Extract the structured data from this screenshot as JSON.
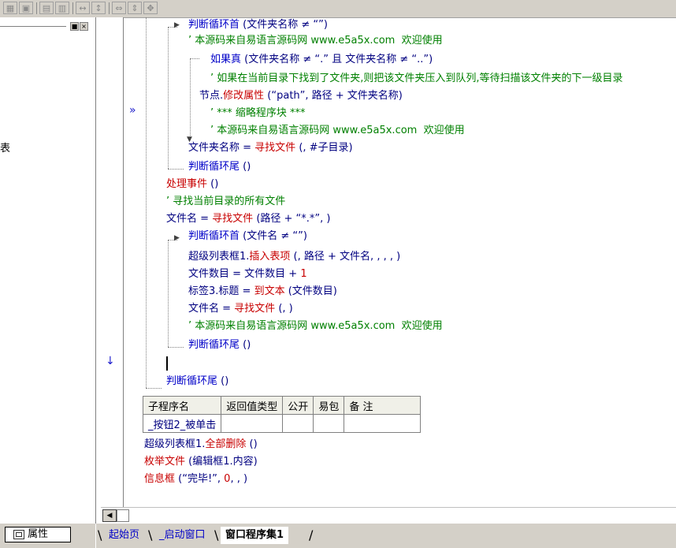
{
  "toolbar": {
    "buttons": [
      {
        "id": "tb1",
        "glyph": "▦"
      },
      {
        "id": "tb2",
        "glyph": "▣"
      },
      {
        "id": "tb3",
        "glyph": "▤"
      },
      {
        "id": "tb4",
        "glyph": "▥"
      },
      {
        "id": "tb5",
        "glyph": "↔"
      },
      {
        "id": "tb6",
        "glyph": "↕"
      },
      {
        "id": "tb7",
        "glyph": "⇔"
      },
      {
        "id": "tb8",
        "glyph": "⇕"
      },
      {
        "id": "tb9",
        "glyph": "✥"
      }
    ]
  },
  "left_panel": {
    "partial_text": "表",
    "pin_glyph": "■",
    "close_glyph": "×",
    "properties_tab": "属性"
  },
  "gutter": {
    "current_marker": "»",
    "down_marker": "↓"
  },
  "code_lines": [
    {
      "parts": [
        {
          "t": "判断循环首",
          "c": "blue"
        },
        {
          "t": " (文件夹名称 ≠ “”)",
          "c": "dark"
        }
      ]
    },
    {
      "parts": [
        {
          "t": "’ 本源码来自易语言源码网 www.e5a5x.com  欢迎使用",
          "c": "green"
        }
      ]
    },
    {
      "parts": [
        {
          "t": "如果真",
          "c": "blue"
        },
        {
          "t": " (文件夹名称 ≠ “.” 且 文件夹名称 ≠ “..”)",
          "c": "dark"
        }
      ]
    },
    {
      "parts": [
        {
          "t": "’ 如果在当前目录下找到了文件夹,则把该文件夹压入到队列,等待扫描该文件夹的下一级目录",
          "c": "green"
        }
      ]
    },
    {
      "parts": [
        {
          "t": "节点.",
          "c": "dark"
        },
        {
          "t": "修改属性",
          "c": "red"
        },
        {
          "t": " (“path”, 路径 + 文件夹名称)",
          "c": "dark"
        }
      ]
    },
    {
      "parts": [
        {
          "t": "’ *** 缩略程序块 ***",
          "c": "green"
        }
      ]
    },
    {
      "parts": [
        {
          "t": "’ 本源码来自易语言源码网 www.e5a5x.com  欢迎使用",
          "c": "green"
        }
      ]
    },
    {
      "parts": [
        {
          "t": "文件夹名称 = ",
          "c": "dark"
        },
        {
          "t": "寻找文件",
          "c": "red"
        },
        {
          "t": " (, #子目录)",
          "c": "dark"
        }
      ]
    },
    {
      "parts": [
        {
          "t": "判断循环尾",
          "c": "blue"
        },
        {
          "t": " ()",
          "c": "dark"
        }
      ]
    },
    {
      "parts": [
        {
          "t": "处理事件",
          "c": "red"
        },
        {
          "t": " ()",
          "c": "dark"
        }
      ]
    },
    {
      "parts": [
        {
          "t": "’ 寻找当前目录的所有文件",
          "c": "green"
        }
      ]
    },
    {
      "parts": [
        {
          "t": "文件名 = ",
          "c": "dark"
        },
        {
          "t": "寻找文件",
          "c": "red"
        },
        {
          "t": " (路径 + “*.*”, )",
          "c": "dark"
        }
      ]
    },
    {
      "parts": [
        {
          "t": "判断循环首",
          "c": "blue"
        },
        {
          "t": " (文件名 ≠ “”)",
          "c": "dark"
        }
      ]
    },
    {
      "parts": [
        {
          "t": "超级列表框1.",
          "c": "dark"
        },
        {
          "t": "插入表项",
          "c": "red"
        },
        {
          "t": " (, 路径 + 文件名, , , , )",
          "c": "dark"
        }
      ]
    },
    {
      "parts": [
        {
          "t": "文件数目 = 文件数目 + ",
          "c": "dark"
        },
        {
          "t": "1",
          "c": "red"
        }
      ]
    },
    {
      "parts": [
        {
          "t": "标签3.标题 = ",
          "c": "dark"
        },
        {
          "t": "到文本",
          "c": "red"
        },
        {
          "t": " (文件数目)",
          "c": "dark"
        }
      ]
    },
    {
      "parts": [
        {
          "t": "文件名 = ",
          "c": "dark"
        },
        {
          "t": "寻找文件",
          "c": "red"
        },
        {
          "t": " (, )",
          "c": "dark"
        }
      ]
    },
    {
      "parts": [
        {
          "t": "’ 本源码来自易语言源码网 www.e5a5x.com  欢迎使用",
          "c": "green"
        }
      ]
    },
    {
      "parts": [
        {
          "t": "判断循环尾",
          "c": "blue"
        },
        {
          "t": " ()",
          "c": "dark"
        }
      ]
    },
    {
      "parts": []
    },
    {
      "parts": [
        {
          "t": "判断循环尾",
          "c": "blue"
        },
        {
          "t": " ()",
          "c": "dark"
        }
      ]
    }
  ],
  "sub_table": {
    "headers": [
      "子程序名",
      "返回值类型",
      "公开",
      "易包",
      "备 注"
    ],
    "row": [
      "_按钮2_被单击",
      "",
      "",
      "",
      ""
    ]
  },
  "after_lines": [
    {
      "parts": [
        {
          "t": "超级列表框1.",
          "c": "dark"
        },
        {
          "t": "全部删除",
          "c": "red"
        },
        {
          "t": " ()",
          "c": "dark"
        }
      ]
    },
    {
      "parts": [
        {
          "t": "枚举文件",
          "c": "red"
        },
        {
          "t": " (编辑框1.内容)",
          "c": "dark"
        }
      ]
    },
    {
      "parts": [
        {
          "t": "信息框",
          "c": "red"
        },
        {
          "t": " (“完毕!”, ",
          "c": "dark"
        },
        {
          "t": "0",
          "c": "red"
        },
        {
          "t": ", , )",
          "c": "dark"
        }
      ]
    }
  ],
  "scrollbar": {
    "left_glyph": "◀"
  },
  "tabs": [
    {
      "label": "起始页",
      "active": false
    },
    {
      "label": "_启动窗口",
      "active": false
    },
    {
      "label": "窗口程序集1",
      "active": true
    }
  ],
  "colors": {
    "keyword": "#0000c8",
    "function": "#c80000",
    "comment": "#008000",
    "text": "#000080"
  }
}
